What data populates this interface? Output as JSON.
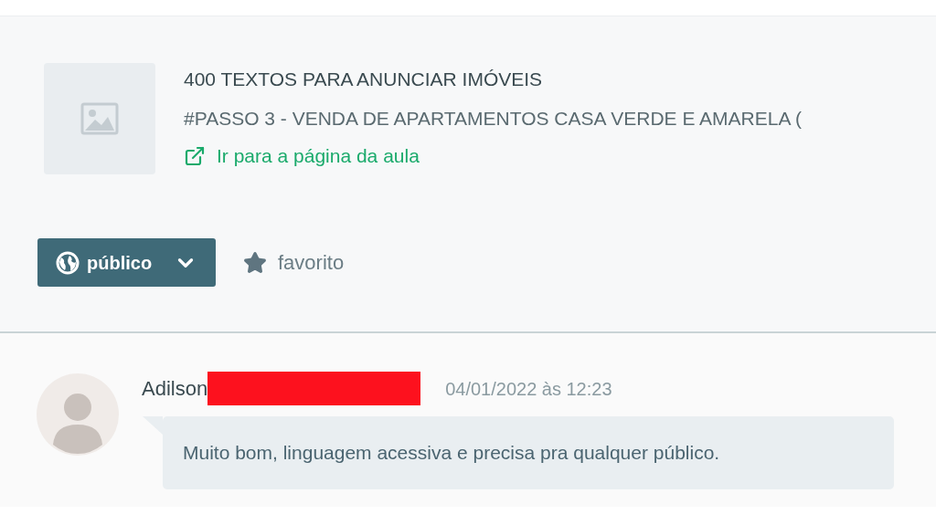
{
  "lesson": {
    "title": "400 TEXTOS PARA ANUNCIAR IMÓVEIS",
    "subtitle": "#PASSO 3 - VENDA DE APARTAMENTOS CASA VERDE E AMARELA (",
    "link": "Ir para a página da aula"
  },
  "visibility_dropdown": {
    "label": "público"
  },
  "favorite_button": {
    "label": "favorito"
  },
  "comments": [
    {
      "author": "Adilson",
      "redacted": true,
      "timestamp": "04/01/2022 às 12:23",
      "text": "Muito bom, linguagem acessiva e precisa pra qualquer público."
    }
  ]
}
